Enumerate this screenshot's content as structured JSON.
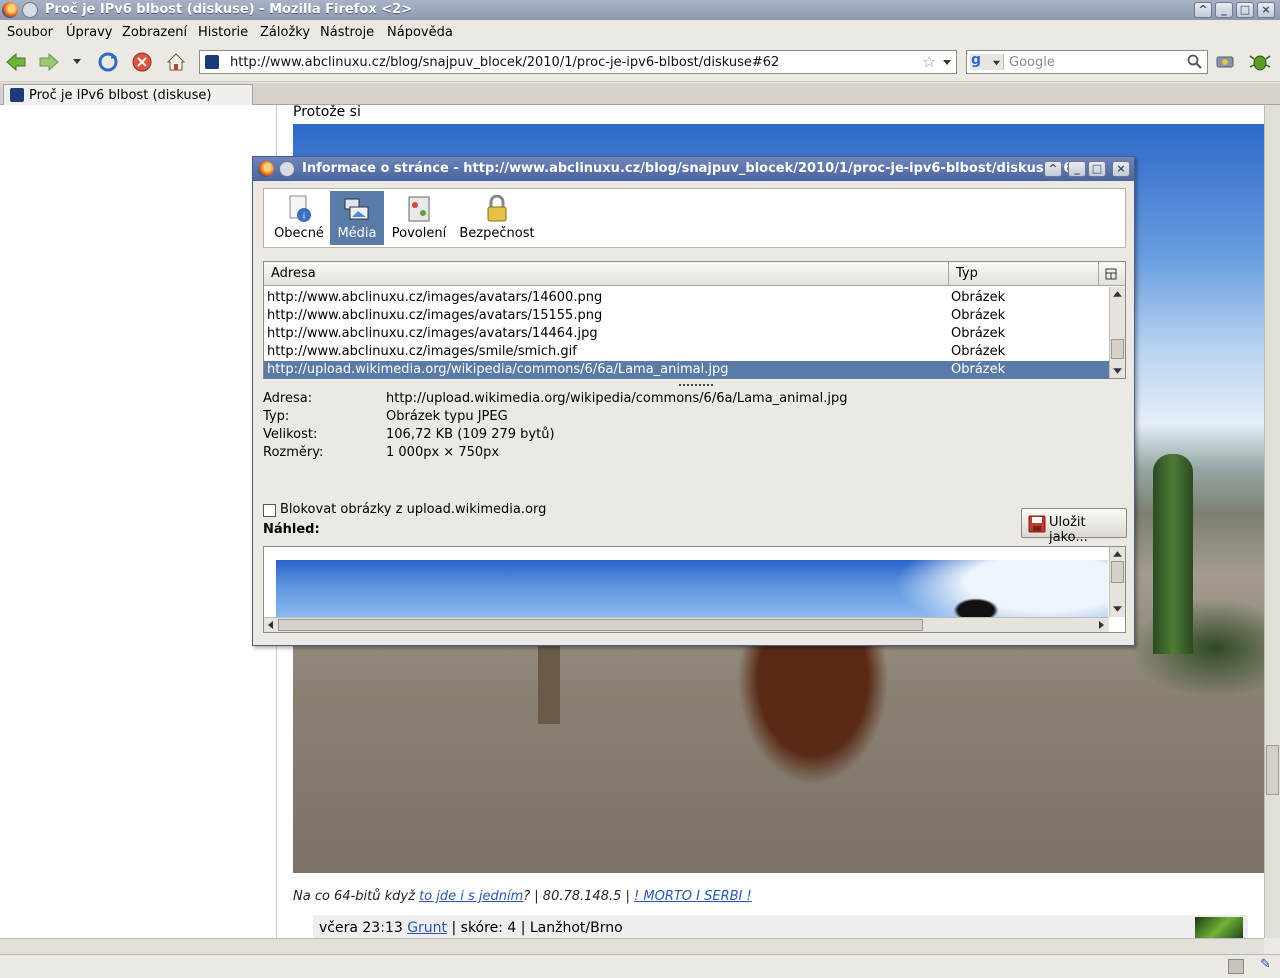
{
  "window": {
    "title": "Proč je IPv6 blbost (diskuse) - Mozilla Firefox <2>"
  },
  "menu": [
    "Soubor",
    "Úpravy",
    "Zobrazení",
    "Historie",
    "Záložky",
    "Nástroje",
    "Nápověda"
  ],
  "nav": {
    "url": "http://www.abclinuxu.cz/blog/snajpuv_blocek/2010/1/proc-je-ipv6-blbost/diskuse#62",
    "search_placeholder": "Google"
  },
  "tab": {
    "label": "Proč je IPv6 blbost (diskuse)"
  },
  "page": {
    "intro_text": "Protože si",
    "comment": {
      "prefix": "Na co 64-bitů když ",
      "link1": "to jde i s jedním",
      "mid": "? | 80.78.148.5 | ",
      "link2": "! MORTO I SERBI !"
    },
    "meta": {
      "time": "včera 23:13 ",
      "author": "Grunt",
      "rest": " | skóre: 4 | Lanžhot/Brno"
    }
  },
  "dialog": {
    "title": "Informace o stránce - http://www.abclinuxu.cz/blog/snajpuv_blocek/2010/1/proc-je-ipv6-blbost/diskuse#6",
    "tabs": [
      "Obecné",
      "Média",
      "Povolení",
      "Bezpečnost"
    ],
    "columns": {
      "address": "Adresa",
      "type": "Typ"
    },
    "rows": [
      {
        "url": "http://www.abclinuxu.cz/images/avatars/14600.png",
        "type": "Obrázek"
      },
      {
        "url": "http://www.abclinuxu.cz/images/avatars/15155.png",
        "type": "Obrázek"
      },
      {
        "url": "http://www.abclinuxu.cz/images/avatars/14464.jpg",
        "type": "Obrázek"
      },
      {
        "url": "http://www.abclinuxu.cz/images/smile/smich.gif",
        "type": "Obrázek"
      },
      {
        "url": "http://upload.wikimedia.org/wikipedia/commons/6/6a/Lama_animal.jpg",
        "type": "Obrázek"
      }
    ],
    "details": {
      "address_label": "Adresa:",
      "address_value": "http://upload.wikimedia.org/wikipedia/commons/6/6a/Lama_animal.jpg",
      "type_label": "Typ:",
      "type_value": "Obrázek typu JPEG",
      "size_label": "Velikost:",
      "size_value": "106,72 KB (109 279 bytů)",
      "dims_label": "Rozměry:",
      "dims_value": "1 000px × 750px"
    },
    "block_label": "Blokovat obrázky z upload.wikimedia.org",
    "save_label": "Uložit jako...",
    "preview_label": "Náhled:"
  },
  "colors": {
    "selection": "#5a7aa8",
    "link": "#2a55b3",
    "dialog_title": "#4a64a0"
  }
}
